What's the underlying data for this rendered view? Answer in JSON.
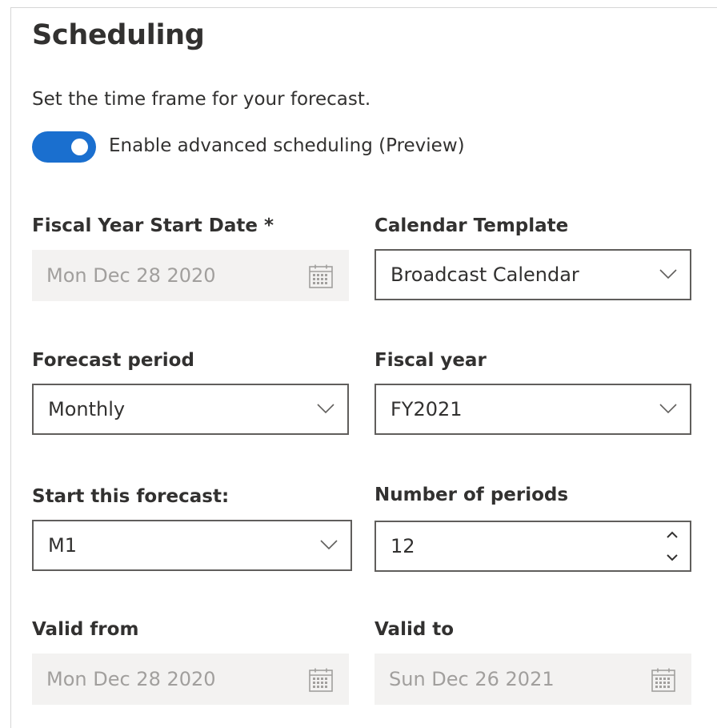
{
  "header": {
    "title": "Scheduling",
    "subtitle": "Set the time frame for your forecast."
  },
  "advanced_toggle": {
    "label": "Enable advanced scheduling (Preview)",
    "on": true,
    "color": "#1a6fcf"
  },
  "fields": {
    "fiscal_year_start_date": {
      "label": "Fiscal Year Start Date *",
      "value": "Mon Dec 28 2020",
      "disabled": true,
      "icon": "calendar-icon"
    },
    "calendar_template": {
      "label": "Calendar Template",
      "value": "Broadcast Calendar",
      "icon": "chevron-down-icon"
    },
    "forecast_period": {
      "label": "Forecast period",
      "value": "Monthly",
      "icon": "chevron-down-icon"
    },
    "fiscal_year": {
      "label": "Fiscal year",
      "value": "FY2021",
      "icon": "chevron-down-icon"
    },
    "start_forecast": {
      "label": "Start this forecast:",
      "value": "M1",
      "icon": "chevron-down-icon"
    },
    "number_of_periods": {
      "label": "Number of periods",
      "value": "12",
      "icon": "stepper-icon"
    },
    "valid_from": {
      "label": "Valid from",
      "value": "Mon Dec 28 2020",
      "disabled": true,
      "icon": "calendar-icon"
    },
    "valid_to": {
      "label": "Valid to",
      "value": "Sun Dec 26 2021",
      "disabled": true,
      "icon": "calendar-icon"
    }
  },
  "colors": {
    "text": "#323130",
    "disabled_bg": "#f3f2f1",
    "disabled_text": "#a19f9d",
    "border": "#605e5c"
  }
}
